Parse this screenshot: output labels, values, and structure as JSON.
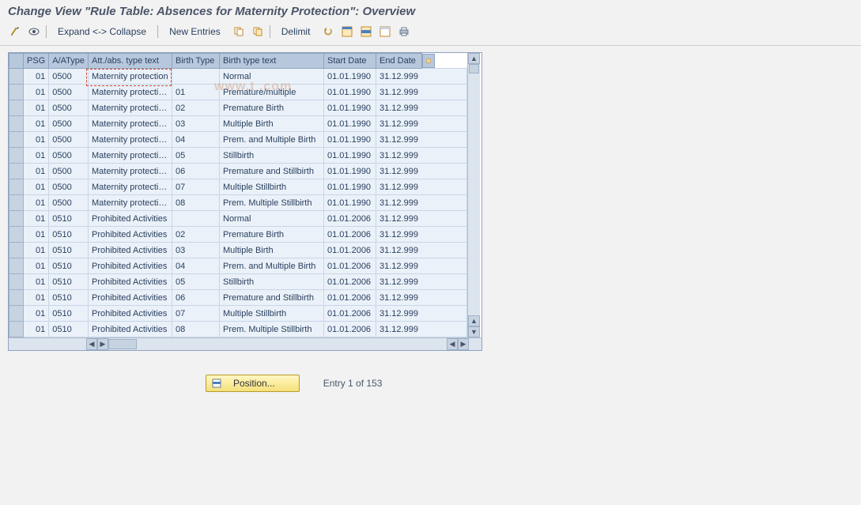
{
  "title": "Change View \"Rule Table: Absences for Maternity Protection\": Overview",
  "toolbar": {
    "expand_collapse": "Expand <-> Collapse",
    "new_entries": "New Entries",
    "delimit": "Delimit"
  },
  "columns": {
    "sel": "",
    "psg": "PSG",
    "atype": "A/AType",
    "atext": "Att./abs. type text",
    "btype": "Birth Type",
    "btext": "Birth type text",
    "start": "Start Date",
    "end": "End Date"
  },
  "rows": [
    {
      "psg": "01",
      "atype": "0500",
      "atext": "Maternity protection",
      "btype": "",
      "btext": "Normal",
      "start": "01.01.1990",
      "end": "31.12.999"
    },
    {
      "psg": "01",
      "atype": "0500",
      "atext": "Maternity protecti…",
      "btype": "01",
      "btext": "Premature/multiple",
      "start": "01.01.1990",
      "end": "31.12.999"
    },
    {
      "psg": "01",
      "atype": "0500",
      "atext": "Maternity protecti…",
      "btype": "02",
      "btext": "Premature Birth",
      "start": "01.01.1990",
      "end": "31.12.999"
    },
    {
      "psg": "01",
      "atype": "0500",
      "atext": "Maternity protecti…",
      "btype": "03",
      "btext": "Multiple Birth",
      "start": "01.01.1990",
      "end": "31.12.999"
    },
    {
      "psg": "01",
      "atype": "0500",
      "atext": "Maternity protecti…",
      "btype": "04",
      "btext": "Prem. and Multiple Birth",
      "start": "01.01.1990",
      "end": "31.12.999"
    },
    {
      "psg": "01",
      "atype": "0500",
      "atext": "Maternity protecti…",
      "btype": "05",
      "btext": "Stillbirth",
      "start": "01.01.1990",
      "end": "31.12.999"
    },
    {
      "psg": "01",
      "atype": "0500",
      "atext": "Maternity protecti…",
      "btype": "06",
      "btext": "Premature and Stillbirth",
      "start": "01.01.1990",
      "end": "31.12.999"
    },
    {
      "psg": "01",
      "atype": "0500",
      "atext": "Maternity protecti…",
      "btype": "07",
      "btext": "Multiple Stillbirth",
      "start": "01.01.1990",
      "end": "31.12.999"
    },
    {
      "psg": "01",
      "atype": "0500",
      "atext": "Maternity protecti…",
      "btype": "08",
      "btext": "Prem. Multiple Stillbirth",
      "start": "01.01.1990",
      "end": "31.12.999"
    },
    {
      "psg": "01",
      "atype": "0510",
      "atext": "Prohibited Activities",
      "btype": "",
      "btext": "Normal",
      "start": "01.01.2006",
      "end": "31.12.999"
    },
    {
      "psg": "01",
      "atype": "0510",
      "atext": "Prohibited Activities",
      "btype": "02",
      "btext": "Premature Birth",
      "start": "01.01.2006",
      "end": "31.12.999"
    },
    {
      "psg": "01",
      "atype": "0510",
      "atext": "Prohibited Activities",
      "btype": "03",
      "btext": "Multiple Birth",
      "start": "01.01.2006",
      "end": "31.12.999"
    },
    {
      "psg": "01",
      "atype": "0510",
      "atext": "Prohibited Activities",
      "btype": "04",
      "btext": "Prem. and Multiple Birth",
      "start": "01.01.2006",
      "end": "31.12.999"
    },
    {
      "psg": "01",
      "atype": "0510",
      "atext": "Prohibited Activities",
      "btype": "05",
      "btext": "Stillbirth",
      "start": "01.01.2006",
      "end": "31.12.999"
    },
    {
      "psg": "01",
      "atype": "0510",
      "atext": "Prohibited Activities",
      "btype": "06",
      "btext": "Premature and Stillbirth",
      "start": "01.01.2006",
      "end": "31.12.999"
    },
    {
      "psg": "01",
      "atype": "0510",
      "atext": "Prohibited Activities",
      "btype": "07",
      "btext": "Multiple Stillbirth",
      "start": "01.01.2006",
      "end": "31.12.999"
    },
    {
      "psg": "01",
      "atype": "0510",
      "atext": "Prohibited Activities",
      "btype": "08",
      "btext": "Prem. Multiple Stillbirth",
      "start": "01.01.2006",
      "end": "31.12.999"
    }
  ],
  "footer": {
    "position": "Position...",
    "entry_text": "Entry 1 of 153"
  },
  "watermark": "www.t            .com"
}
